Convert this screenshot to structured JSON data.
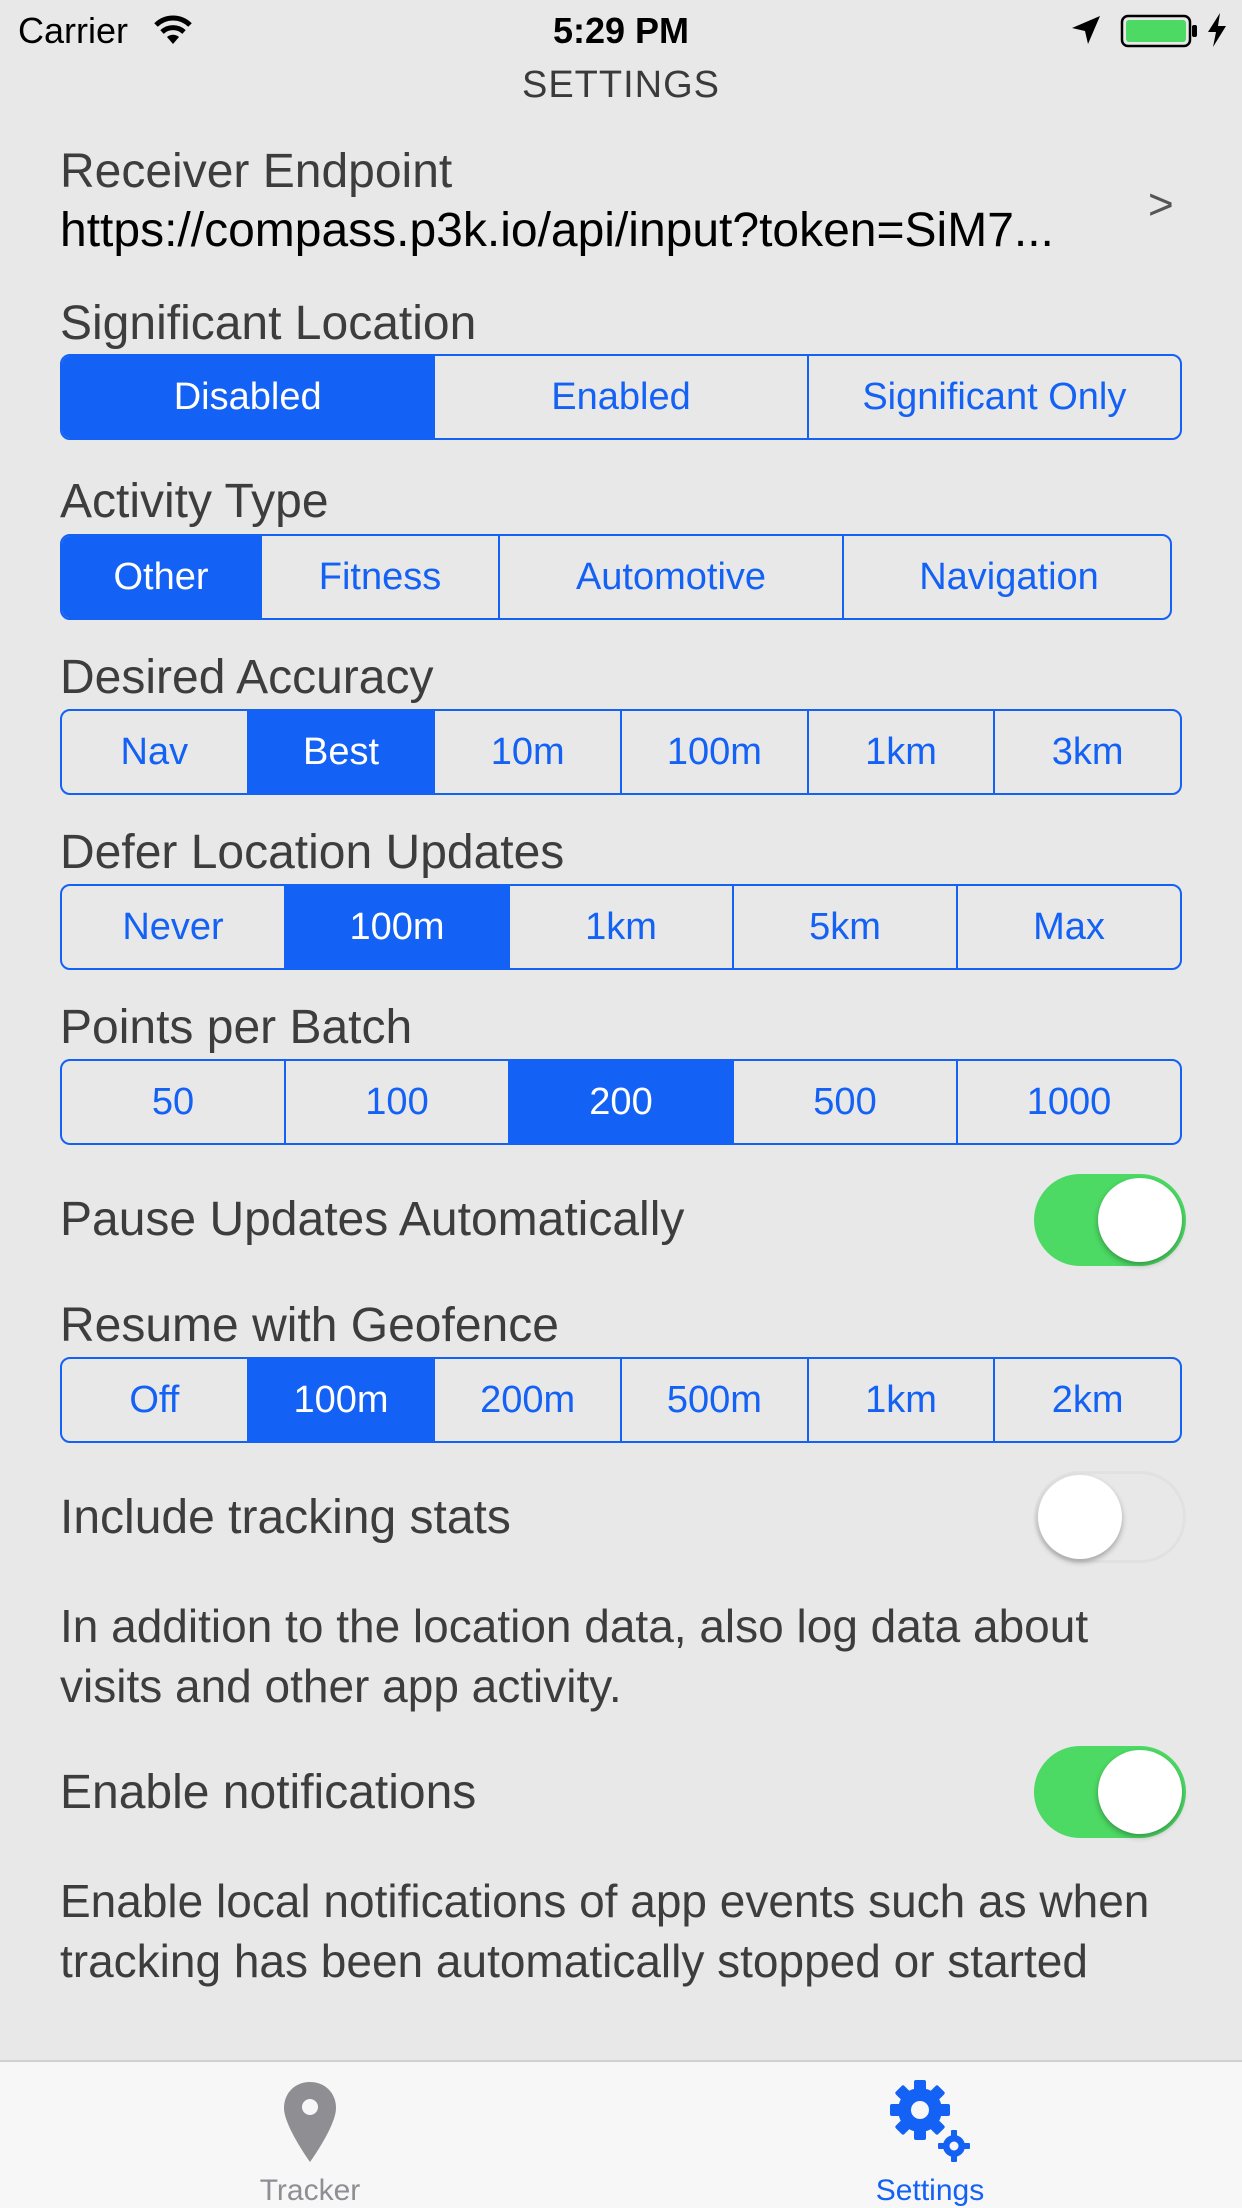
{
  "status_bar": {
    "carrier": "Carrier",
    "time": "5:29 PM"
  },
  "nav": {
    "title": "SETTINGS"
  },
  "receiver": {
    "label": "Receiver Endpoint",
    "url": "https://compass.p3k.io/api/input?token=SiM7...",
    "disclosure": ">"
  },
  "significant_location": {
    "label": "Significant Location",
    "options": [
      "Disabled",
      "Enabled",
      "Significant Only"
    ],
    "selected": "Disabled"
  },
  "activity_type": {
    "label": "Activity Type",
    "options": [
      "Other",
      "Fitness",
      "Automotive",
      "Navigation"
    ],
    "selected": "Other"
  },
  "desired_accuracy": {
    "label": "Desired Accuracy",
    "options": [
      "Nav",
      "Best",
      "10m",
      "100m",
      "1km",
      "3km"
    ],
    "selected": "Best"
  },
  "defer_updates": {
    "label": "Defer Location Updates",
    "options": [
      "Never",
      "100m",
      "1km",
      "5km",
      "Max"
    ],
    "selected": "100m"
  },
  "points_per_batch": {
    "label": "Points per Batch",
    "options": [
      "50",
      "100",
      "200",
      "500",
      "1000"
    ],
    "selected": "200"
  },
  "pause_updates": {
    "label": "Pause Updates Automatically",
    "on": true
  },
  "resume_geofence": {
    "label": "Resume with Geofence",
    "options": [
      "Off",
      "100m",
      "200m",
      "500m",
      "1km",
      "2km"
    ],
    "selected": "100m"
  },
  "tracking_stats": {
    "label": "Include tracking stats",
    "on": false,
    "description": "In addition to the location data, also log data about visits and other app activity."
  },
  "notifications": {
    "label": "Enable notifications",
    "on": true,
    "description": "Enable local notifications of app events such as when tracking has been automatically stopped or started"
  },
  "tab_bar": {
    "tabs": [
      {
        "label": "Tracker",
        "icon": "map-pin-icon",
        "active": false
      },
      {
        "label": "Settings",
        "icon": "gear-icon",
        "active": true
      }
    ]
  },
  "colors": {
    "accent": "#1361f5",
    "toggle_on": "#4cd964",
    "background": "#e8e8e8",
    "battery": "#4cd964"
  }
}
